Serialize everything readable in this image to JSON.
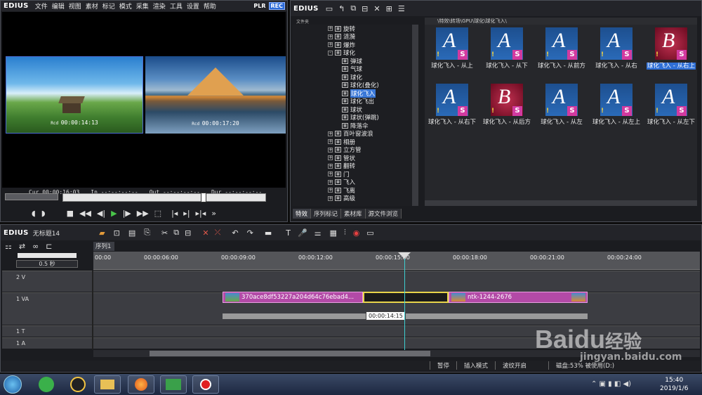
{
  "player": {
    "menu": [
      "文件",
      "编辑",
      "视图",
      "素材",
      "标记",
      "模式",
      "采集",
      "渲染",
      "工具",
      "设置",
      "帮助"
    ],
    "plr": "PLR",
    "rec": "REC",
    "clip_a_tc": "00:00:14:13",
    "clip_b_tc": "00:00:17:20",
    "cur_label": "Cur",
    "cur_value": "00:00:16:03",
    "in_label": "In",
    "in_value": "--:--:--:--",
    "out_label": "Out",
    "out_value": "--:--:--:--",
    "dur_label": "Dur",
    "dur_value": "--:--:--:--"
  },
  "app_name": "EDIUS",
  "browser": {
    "tree_header": "文件夹",
    "path": "\\特效\\转场\\GPU\\球化\\球化飞入\\",
    "tree": [
      {
        "label": "旋转",
        "pm": "+",
        "indent": 0
      },
      {
        "label": "涟漪",
        "pm": "+",
        "indent": 0
      },
      {
        "label": "爆炸",
        "pm": "+",
        "indent": 0
      },
      {
        "label": "球化",
        "pm": "-",
        "indent": 0
      },
      {
        "label": "弹球",
        "pm": "",
        "indent": 1
      },
      {
        "label": "气球",
        "pm": "",
        "indent": 1
      },
      {
        "label": "球化",
        "pm": "",
        "indent": 1
      },
      {
        "label": "球化(叠化)",
        "pm": "",
        "indent": 1
      },
      {
        "label": "球化飞入",
        "pm": "",
        "indent": 1,
        "selected": true
      },
      {
        "label": "球化飞出",
        "pm": "",
        "indent": 1
      },
      {
        "label": "球状",
        "pm": "",
        "indent": 1
      },
      {
        "label": "球状(弹跳)",
        "pm": "",
        "indent": 1
      },
      {
        "label": "降落伞",
        "pm": "",
        "indent": 1
      },
      {
        "label": "百叶窗波浪",
        "pm": "+",
        "indent": 0
      },
      {
        "label": "相册",
        "pm": "+",
        "indent": 0
      },
      {
        "label": "立方管",
        "pm": "+",
        "indent": 0
      },
      {
        "label": "管状",
        "pm": "+",
        "indent": 0
      },
      {
        "label": "翻转",
        "pm": "+",
        "indent": 0
      },
      {
        "label": "门",
        "pm": "+",
        "indent": 0
      },
      {
        "label": "飞入",
        "pm": "+",
        "indent": 0
      },
      {
        "label": "飞离",
        "pm": "+",
        "indent": 0
      },
      {
        "label": "高级",
        "pm": "+",
        "indent": 0
      }
    ],
    "tiles": [
      {
        "label": "球化飞入 - 从上",
        "letter": "A"
      },
      {
        "label": "球化飞入 - 从下",
        "letter": "A"
      },
      {
        "label": "球化飞入 - 从前方",
        "letter": "A"
      },
      {
        "label": "球化飞入 - 从右",
        "letter": "A"
      },
      {
        "label": "球化飞入 - 从右上",
        "letter": "B",
        "selected": true
      },
      {
        "label": "球化飞入 - 从右下",
        "letter": "A"
      },
      {
        "label": "球化飞入 - 从后方",
        "letter": "B"
      },
      {
        "label": "球化飞入 - 从左",
        "letter": "A"
      },
      {
        "label": "球化飞入 - 从左上",
        "letter": "A"
      },
      {
        "label": "球化飞入 - 从左下",
        "letter": "A"
      }
    ],
    "tabs": [
      "特效",
      "序列标记",
      "素材库",
      "源文件浏览"
    ]
  },
  "timeline": {
    "project": "无标题14",
    "sequence_tab": "序列1",
    "scale": "0.5 秒",
    "ruler": [
      "00:00",
      "00:00:06:00",
      "00:00:09:00",
      "00:00:12:00",
      "00:00:15:00",
      "00:00:18:00",
      "00:00:21:00",
      "00:00:24:00"
    ],
    "tracks": [
      "2 V",
      "1 VA",
      "1 T",
      "1 A"
    ],
    "clip1": "370ace8df53227a204d64c76ebad4...",
    "clip2": "ntk-1244-2676",
    "tooltip": "00:00:14:15",
    "status": [
      "暂停",
      "插入模式",
      "波纹开启",
      "",
      "磁盘:53% 被使用(D:)"
    ]
  },
  "taskbar": {
    "time": "15:40",
    "date": "2019/1/6"
  },
  "watermark": {
    "text1": "Baidu",
    "text2": "经验",
    "url": "jingyan.baidu.com"
  }
}
